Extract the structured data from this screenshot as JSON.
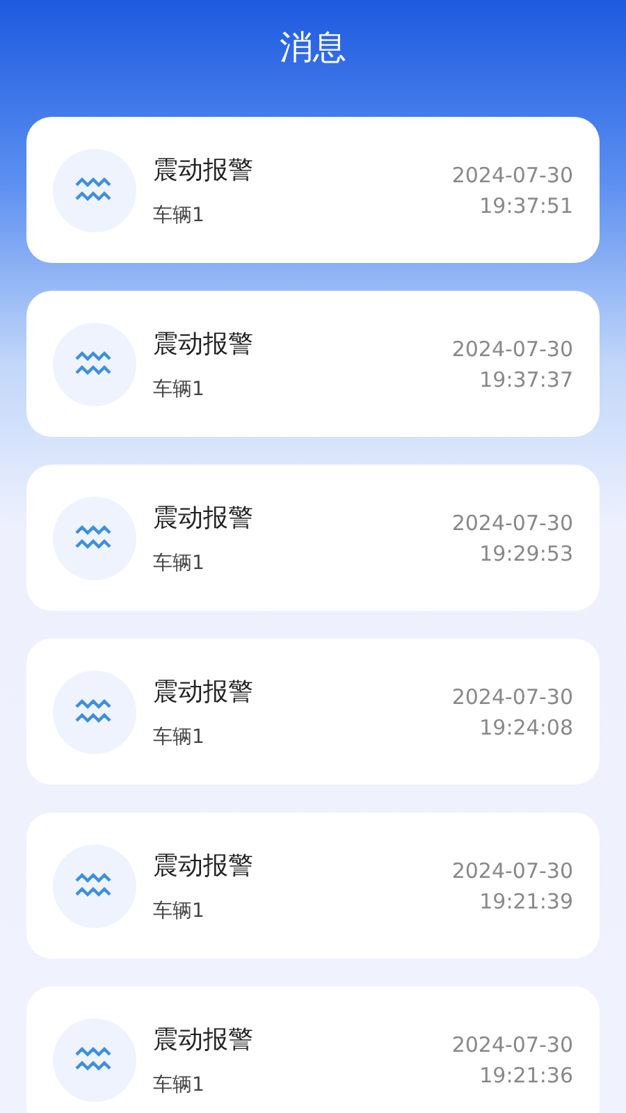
{
  "header": {
    "title": "消息"
  },
  "messages": [
    {
      "title": "震动报警",
      "vehicle": "车辆1",
      "date": "2024-07-30",
      "time": "19:37:51"
    },
    {
      "title": "震动报警",
      "vehicle": "车辆1",
      "date": "2024-07-30",
      "time": "19:37:37"
    },
    {
      "title": "震动报警",
      "vehicle": "车辆1",
      "date": "2024-07-30",
      "time": "19:29:53"
    },
    {
      "title": "震动报警",
      "vehicle": "车辆1",
      "date": "2024-07-30",
      "time": "19:24:08"
    },
    {
      "title": "震动报警",
      "vehicle": "车辆1",
      "date": "2024-07-30",
      "time": "19:21:39"
    },
    {
      "title": "震动报警",
      "vehicle": "车辆1",
      "date": "2024-07-30",
      "time": "19:21:36"
    }
  ]
}
